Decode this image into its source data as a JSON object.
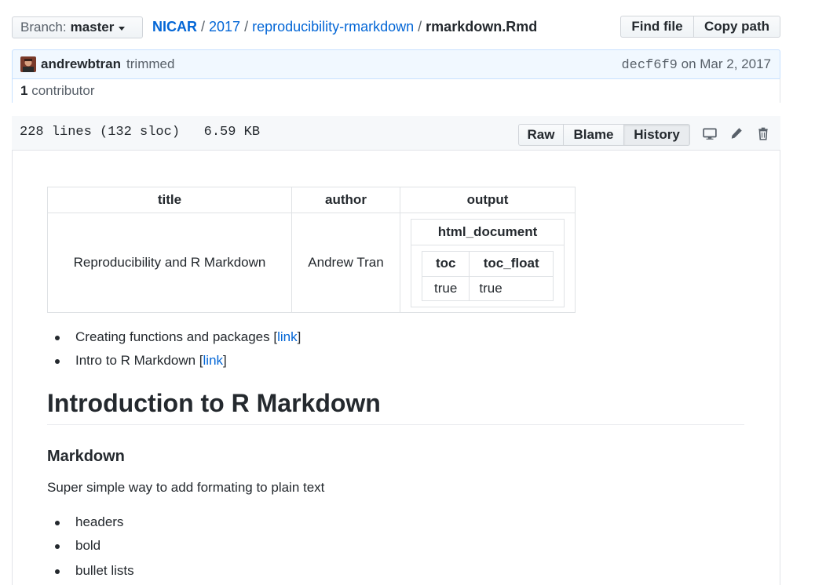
{
  "branch": {
    "label": "Branch:",
    "value": "master"
  },
  "breadcrumb": {
    "root": "NICAR",
    "folder1": "2017",
    "folder2": "reproducibility-rmarkdown",
    "file": "rmarkdown.Rmd",
    "separator": "/"
  },
  "top_actions": {
    "find_file": "Find file",
    "copy_path": "Copy path"
  },
  "commit": {
    "author": "andrewbtran",
    "message": "trimmed",
    "sha": "decf6f9",
    "date_prefix": "on",
    "date": "Mar 2, 2017"
  },
  "contributors": {
    "count": "1",
    "label": "contributor"
  },
  "file": {
    "info": "228 lines (132 sloc)   6.59 KB",
    "raw": "Raw",
    "blame": "Blame",
    "history": "History"
  },
  "icons": {
    "display": "desktop-icon",
    "edit": "pencil-icon",
    "delete": "trash-icon"
  },
  "yaml": {
    "headers": [
      "title",
      "author",
      "output"
    ],
    "title": "Reproducibility and R Markdown",
    "author": "Andrew Tran",
    "output_header": "html_document",
    "sub_headers": [
      "toc",
      "toc_float"
    ],
    "sub_values": [
      "true",
      "true"
    ]
  },
  "links_list": [
    {
      "text": "Creating functions and packages [",
      "link": "link",
      "end": "]"
    },
    {
      "text": "Intro to R Markdown [",
      "link": "link",
      "end": "]"
    }
  ],
  "heading1": "Introduction to R Markdown",
  "heading3": "Markdown",
  "paragraph": "Super simple way to add formating to plain text",
  "bullets": [
    "headers",
    "bold",
    "bullet lists"
  ],
  "colors": {
    "link": "#0366d6",
    "commit_bg": "#f1f8ff",
    "border": "#e1e4e8"
  }
}
